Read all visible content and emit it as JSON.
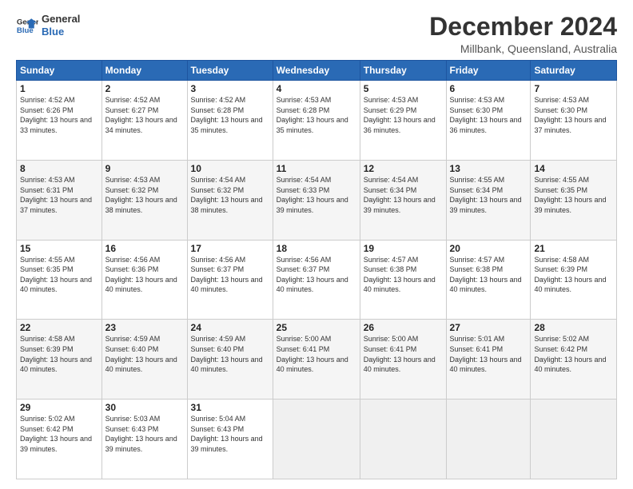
{
  "header": {
    "logo_line1": "General",
    "logo_line2": "Blue",
    "title": "December 2024",
    "subtitle": "Millbank, Queensland, Australia"
  },
  "calendar": {
    "days_of_week": [
      "Sunday",
      "Monday",
      "Tuesday",
      "Wednesday",
      "Thursday",
      "Friday",
      "Saturday"
    ],
    "weeks": [
      [
        {
          "day": "",
          "empty": true
        },
        {
          "day": "",
          "empty": true
        },
        {
          "day": "",
          "empty": true
        },
        {
          "day": "",
          "empty": true
        },
        {
          "day": "",
          "empty": true
        },
        {
          "day": "",
          "empty": true
        },
        {
          "day": "",
          "empty": true
        }
      ],
      [
        {
          "day": "1",
          "sunrise": "4:52 AM",
          "sunset": "6:26 PM",
          "daylight": "13 hours and 33 minutes."
        },
        {
          "day": "2",
          "sunrise": "4:52 AM",
          "sunset": "6:27 PM",
          "daylight": "13 hours and 34 minutes."
        },
        {
          "day": "3",
          "sunrise": "4:52 AM",
          "sunset": "6:28 PM",
          "daylight": "13 hours and 35 minutes."
        },
        {
          "day": "4",
          "sunrise": "4:53 AM",
          "sunset": "6:28 PM",
          "daylight": "13 hours and 35 minutes."
        },
        {
          "day": "5",
          "sunrise": "4:53 AM",
          "sunset": "6:29 PM",
          "daylight": "13 hours and 36 minutes."
        },
        {
          "day": "6",
          "sunrise": "4:53 AM",
          "sunset": "6:30 PM",
          "daylight": "13 hours and 36 minutes."
        },
        {
          "day": "7",
          "sunrise": "4:53 AM",
          "sunset": "6:30 PM",
          "daylight": "13 hours and 37 minutes."
        }
      ],
      [
        {
          "day": "8",
          "sunrise": "4:53 AM",
          "sunset": "6:31 PM",
          "daylight": "13 hours and 37 minutes."
        },
        {
          "day": "9",
          "sunrise": "4:53 AM",
          "sunset": "6:32 PM",
          "daylight": "13 hours and 38 minutes."
        },
        {
          "day": "10",
          "sunrise": "4:54 AM",
          "sunset": "6:32 PM",
          "daylight": "13 hours and 38 minutes."
        },
        {
          "day": "11",
          "sunrise": "4:54 AM",
          "sunset": "6:33 PM",
          "daylight": "13 hours and 39 minutes."
        },
        {
          "day": "12",
          "sunrise": "4:54 AM",
          "sunset": "6:34 PM",
          "daylight": "13 hours and 39 minutes."
        },
        {
          "day": "13",
          "sunrise": "4:55 AM",
          "sunset": "6:34 PM",
          "daylight": "13 hours and 39 minutes."
        },
        {
          "day": "14",
          "sunrise": "4:55 AM",
          "sunset": "6:35 PM",
          "daylight": "13 hours and 39 minutes."
        }
      ],
      [
        {
          "day": "15",
          "sunrise": "4:55 AM",
          "sunset": "6:35 PM",
          "daylight": "13 hours and 40 minutes."
        },
        {
          "day": "16",
          "sunrise": "4:56 AM",
          "sunset": "6:36 PM",
          "daylight": "13 hours and 40 minutes."
        },
        {
          "day": "17",
          "sunrise": "4:56 AM",
          "sunset": "6:37 PM",
          "daylight": "13 hours and 40 minutes."
        },
        {
          "day": "18",
          "sunrise": "4:56 AM",
          "sunset": "6:37 PM",
          "daylight": "13 hours and 40 minutes."
        },
        {
          "day": "19",
          "sunrise": "4:57 AM",
          "sunset": "6:38 PM",
          "daylight": "13 hours and 40 minutes."
        },
        {
          "day": "20",
          "sunrise": "4:57 AM",
          "sunset": "6:38 PM",
          "daylight": "13 hours and 40 minutes."
        },
        {
          "day": "21",
          "sunrise": "4:58 AM",
          "sunset": "6:39 PM",
          "daylight": "13 hours and 40 minutes."
        }
      ],
      [
        {
          "day": "22",
          "sunrise": "4:58 AM",
          "sunset": "6:39 PM",
          "daylight": "13 hours and 40 minutes."
        },
        {
          "day": "23",
          "sunrise": "4:59 AM",
          "sunset": "6:40 PM",
          "daylight": "13 hours and 40 minutes."
        },
        {
          "day": "24",
          "sunrise": "4:59 AM",
          "sunset": "6:40 PM",
          "daylight": "13 hours and 40 minutes."
        },
        {
          "day": "25",
          "sunrise": "5:00 AM",
          "sunset": "6:41 PM",
          "daylight": "13 hours and 40 minutes."
        },
        {
          "day": "26",
          "sunrise": "5:00 AM",
          "sunset": "6:41 PM",
          "daylight": "13 hours and 40 minutes."
        },
        {
          "day": "27",
          "sunrise": "5:01 AM",
          "sunset": "6:41 PM",
          "daylight": "13 hours and 40 minutes."
        },
        {
          "day": "28",
          "sunrise": "5:02 AM",
          "sunset": "6:42 PM",
          "daylight": "13 hours and 40 minutes."
        }
      ],
      [
        {
          "day": "29",
          "sunrise": "5:02 AM",
          "sunset": "6:42 PM",
          "daylight": "13 hours and 39 minutes."
        },
        {
          "day": "30",
          "sunrise": "5:03 AM",
          "sunset": "6:43 PM",
          "daylight": "13 hours and 39 minutes."
        },
        {
          "day": "31",
          "sunrise": "5:04 AM",
          "sunset": "6:43 PM",
          "daylight": "13 hours and 39 minutes."
        },
        {
          "day": "",
          "empty": true
        },
        {
          "day": "",
          "empty": true
        },
        {
          "day": "",
          "empty": true
        },
        {
          "day": "",
          "empty": true
        }
      ]
    ]
  }
}
